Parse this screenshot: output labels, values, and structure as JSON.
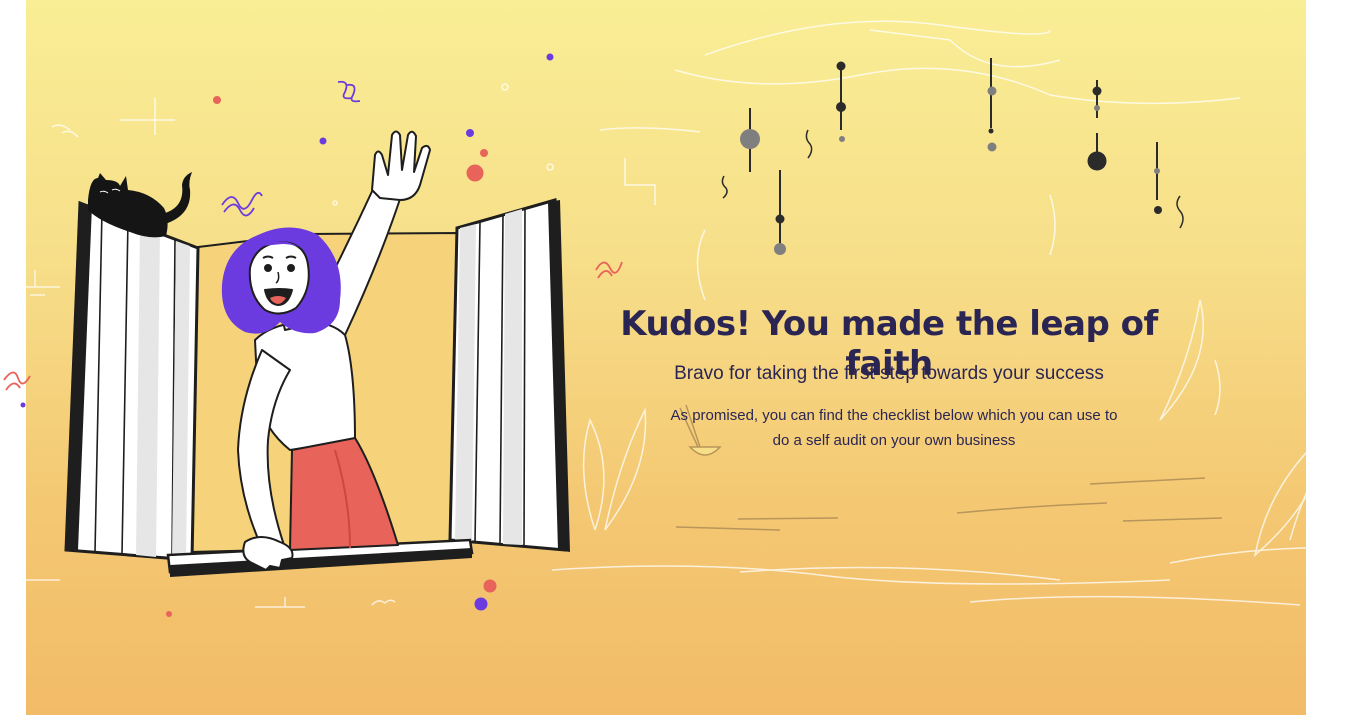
{
  "hero": {
    "headline": "Kudos! You made the leap of faith",
    "subheadline": "Bravo for taking the first step towards your success",
    "body": "As promised, you can find the checklist below which you can use to do a self audit on your own business"
  },
  "colors": {
    "background_top": "#f9ee95",
    "background_bottom": "#f2bb67",
    "heading_text": "#2a2553",
    "hair_purple": "#6b3be0",
    "skirt_coral": "#e8635a"
  },
  "illustration": {
    "icons": [
      "woman-waving-illustration",
      "cat-icon",
      "window-shutters-icon",
      "hanging-mobile-icon",
      "plant-icon",
      "confetti-icon"
    ]
  }
}
